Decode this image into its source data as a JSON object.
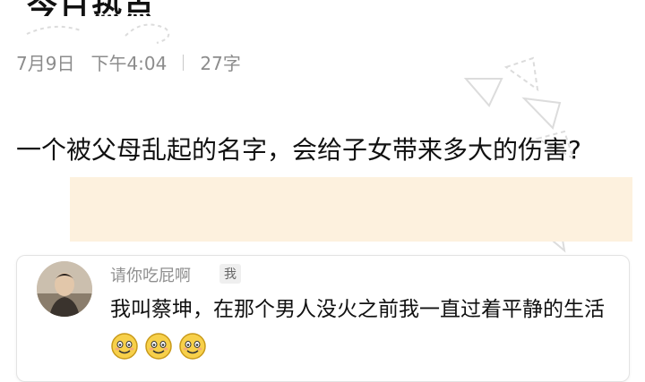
{
  "header": {
    "title": "今日热点"
  },
  "meta": {
    "date": "7月9日",
    "time": "下午4:04",
    "word_count": "27字"
  },
  "question": {
    "text": "一个被父母乱起的名字，会给子女带来多大的伤害?"
  },
  "comment": {
    "username": "请你吃屁啊",
    "badge": "我",
    "text": "我叫蔡坤，在那个男人没火之前我一直过着平静的生活",
    "emoji_icon": "smiling-face-icon",
    "emoji_count": 3
  },
  "colors": {
    "highlight": "#fdf1de",
    "meta_text": "#8c8c8c",
    "card_border": "#e3e3e3"
  }
}
